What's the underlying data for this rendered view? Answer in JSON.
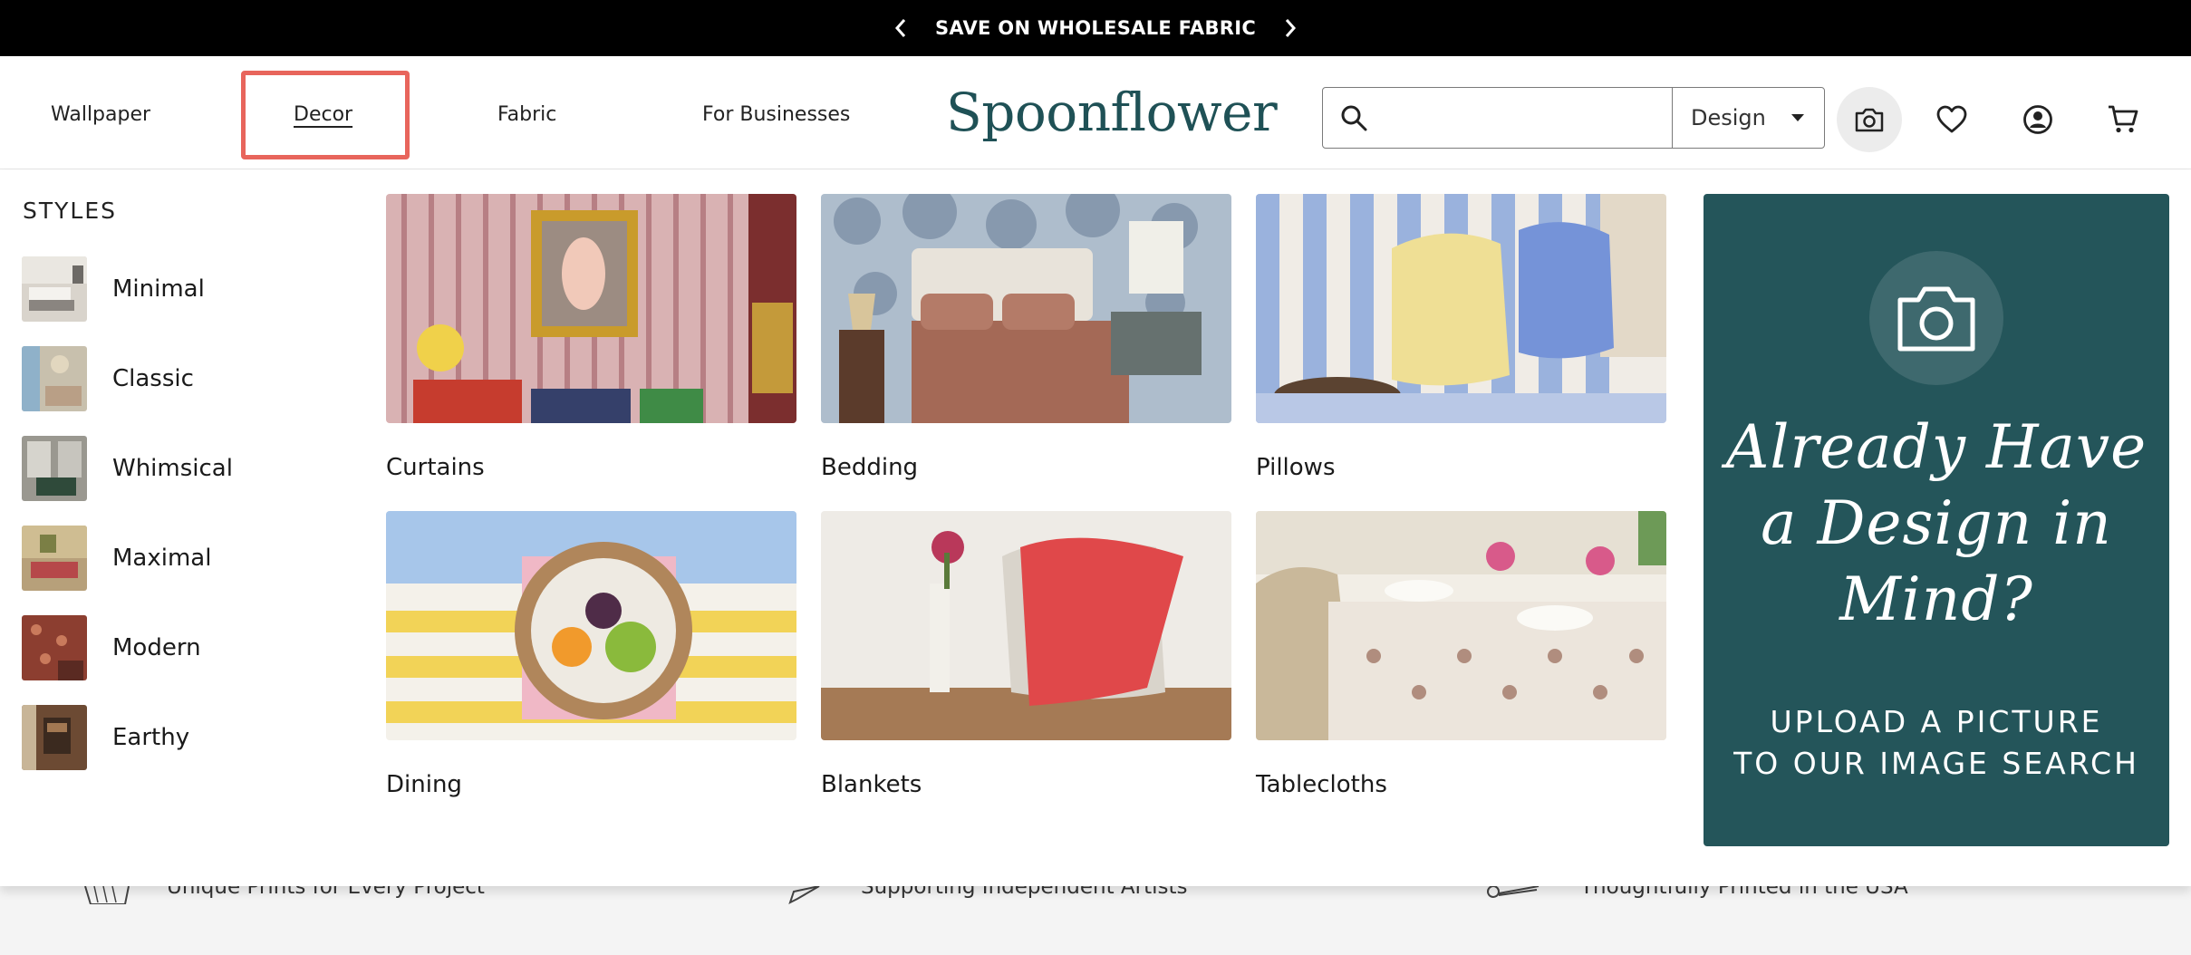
{
  "promo_bar": {
    "text": "SAVE ON WHOLESALE FABRIC"
  },
  "nav": {
    "items": [
      "Wallpaper",
      "Decor",
      "Fabric",
      "For Businesses"
    ],
    "active": "Decor"
  },
  "logo": "Spoonflower",
  "search": {
    "value": "",
    "placeholder": "",
    "category": "Design"
  },
  "icons": {
    "camera": "camera-icon",
    "favorites": "heart-icon",
    "account": "account-icon",
    "cart": "cart-icon"
  },
  "menu": {
    "styles_heading": "STYLES",
    "styles": [
      {
        "label": "Minimal"
      },
      {
        "label": "Classic"
      },
      {
        "label": "Whimsical"
      },
      {
        "label": "Maximal"
      },
      {
        "label": "Modern"
      },
      {
        "label": "Earthy"
      }
    ],
    "categories": [
      {
        "label": "Curtains"
      },
      {
        "label": "Bedding"
      },
      {
        "label": "Pillows"
      },
      {
        "label": "Dining"
      },
      {
        "label": "Blankets"
      },
      {
        "label": "Tablecloths"
      }
    ],
    "promo_card": {
      "headline_lines": [
        "Already Have",
        "a Design in",
        "Mind?"
      ],
      "sub_lines": [
        "UPLOAD A PICTURE",
        "TO OUR IMAGE SEARCH"
      ]
    }
  },
  "value_props": [
    {
      "text": "Unique Prints for Every Project",
      "icon": "fabric-swatch-icon"
    },
    {
      "text": "Supporting Independent Artists",
      "icon": "pen-icon"
    },
    {
      "text": "Thoughtfully Printed in the USA",
      "icon": "scissors-icon"
    }
  ],
  "colors": {
    "brand_teal": "#24555a",
    "logo": "#1f5156",
    "highlight": "#e8655c"
  }
}
